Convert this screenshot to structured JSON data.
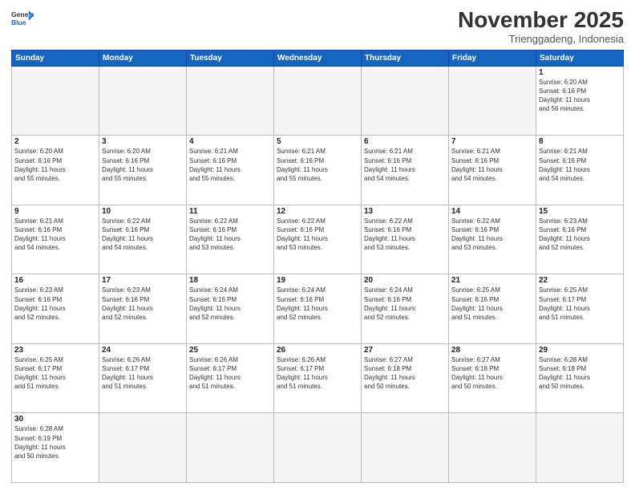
{
  "header": {
    "logo_general": "General",
    "logo_blue": "Blue",
    "month_title": "November 2025",
    "subtitle": "Trienggadeng, Indonesia"
  },
  "weekdays": [
    "Sunday",
    "Monday",
    "Tuesday",
    "Wednesday",
    "Thursday",
    "Friday",
    "Saturday"
  ],
  "weeks": [
    [
      {
        "day": "",
        "info": ""
      },
      {
        "day": "",
        "info": ""
      },
      {
        "day": "",
        "info": ""
      },
      {
        "day": "",
        "info": ""
      },
      {
        "day": "",
        "info": ""
      },
      {
        "day": "",
        "info": ""
      },
      {
        "day": "1",
        "info": "Sunrise: 6:20 AM\nSunset: 6:16 PM\nDaylight: 11 hours\nand 56 minutes."
      }
    ],
    [
      {
        "day": "2",
        "info": "Sunrise: 6:20 AM\nSunset: 6:16 PM\nDaylight: 11 hours\nand 55 minutes."
      },
      {
        "day": "3",
        "info": "Sunrise: 6:20 AM\nSunset: 6:16 PM\nDaylight: 11 hours\nand 55 minutes."
      },
      {
        "day": "4",
        "info": "Sunrise: 6:21 AM\nSunset: 6:16 PM\nDaylight: 11 hours\nand 55 minutes."
      },
      {
        "day": "5",
        "info": "Sunrise: 6:21 AM\nSunset: 6:16 PM\nDaylight: 11 hours\nand 55 minutes."
      },
      {
        "day": "6",
        "info": "Sunrise: 6:21 AM\nSunset: 6:16 PM\nDaylight: 11 hours\nand 54 minutes."
      },
      {
        "day": "7",
        "info": "Sunrise: 6:21 AM\nSunset: 6:16 PM\nDaylight: 11 hours\nand 54 minutes."
      },
      {
        "day": "8",
        "info": "Sunrise: 6:21 AM\nSunset: 6:16 PM\nDaylight: 11 hours\nand 54 minutes."
      }
    ],
    [
      {
        "day": "9",
        "info": "Sunrise: 6:21 AM\nSunset: 6:16 PM\nDaylight: 11 hours\nand 54 minutes."
      },
      {
        "day": "10",
        "info": "Sunrise: 6:22 AM\nSunset: 6:16 PM\nDaylight: 11 hours\nand 54 minutes."
      },
      {
        "day": "11",
        "info": "Sunrise: 6:22 AM\nSunset: 6:16 PM\nDaylight: 11 hours\nand 53 minutes."
      },
      {
        "day": "12",
        "info": "Sunrise: 6:22 AM\nSunset: 6:16 PM\nDaylight: 11 hours\nand 53 minutes."
      },
      {
        "day": "13",
        "info": "Sunrise: 6:22 AM\nSunset: 6:16 PM\nDaylight: 11 hours\nand 53 minutes."
      },
      {
        "day": "14",
        "info": "Sunrise: 6:22 AM\nSunset: 6:16 PM\nDaylight: 11 hours\nand 53 minutes."
      },
      {
        "day": "15",
        "info": "Sunrise: 6:23 AM\nSunset: 6:16 PM\nDaylight: 11 hours\nand 52 minutes."
      }
    ],
    [
      {
        "day": "16",
        "info": "Sunrise: 6:23 AM\nSunset: 6:16 PM\nDaylight: 11 hours\nand 52 minutes."
      },
      {
        "day": "17",
        "info": "Sunrise: 6:23 AM\nSunset: 6:16 PM\nDaylight: 11 hours\nand 52 minutes."
      },
      {
        "day": "18",
        "info": "Sunrise: 6:24 AM\nSunset: 6:16 PM\nDaylight: 11 hours\nand 52 minutes."
      },
      {
        "day": "19",
        "info": "Sunrise: 6:24 AM\nSunset: 6:16 PM\nDaylight: 11 hours\nand 52 minutes."
      },
      {
        "day": "20",
        "info": "Sunrise: 6:24 AM\nSunset: 6:16 PM\nDaylight: 11 hours\nand 52 minutes."
      },
      {
        "day": "21",
        "info": "Sunrise: 6:25 AM\nSunset: 6:16 PM\nDaylight: 11 hours\nand 51 minutes."
      },
      {
        "day": "22",
        "info": "Sunrise: 6:25 AM\nSunset: 6:17 PM\nDaylight: 11 hours\nand 51 minutes."
      }
    ],
    [
      {
        "day": "23",
        "info": "Sunrise: 6:25 AM\nSunset: 6:17 PM\nDaylight: 11 hours\nand 51 minutes."
      },
      {
        "day": "24",
        "info": "Sunrise: 6:26 AM\nSunset: 6:17 PM\nDaylight: 11 hours\nand 51 minutes."
      },
      {
        "day": "25",
        "info": "Sunrise: 6:26 AM\nSunset: 6:17 PM\nDaylight: 11 hours\nand 51 minutes."
      },
      {
        "day": "26",
        "info": "Sunrise: 6:26 AM\nSunset: 6:17 PM\nDaylight: 11 hours\nand 51 minutes."
      },
      {
        "day": "27",
        "info": "Sunrise: 6:27 AM\nSunset: 6:18 PM\nDaylight: 11 hours\nand 50 minutes."
      },
      {
        "day": "28",
        "info": "Sunrise: 6:27 AM\nSunset: 6:18 PM\nDaylight: 11 hours\nand 50 minutes."
      },
      {
        "day": "29",
        "info": "Sunrise: 6:28 AM\nSunset: 6:18 PM\nDaylight: 11 hours\nand 50 minutes."
      }
    ],
    [
      {
        "day": "30",
        "info": "Sunrise: 6:28 AM\nSunset: 6:19 PM\nDaylight: 11 hours\nand 50 minutes."
      },
      {
        "day": "",
        "info": ""
      },
      {
        "day": "",
        "info": ""
      },
      {
        "day": "",
        "info": ""
      },
      {
        "day": "",
        "info": ""
      },
      {
        "day": "",
        "info": ""
      },
      {
        "day": "",
        "info": ""
      }
    ]
  ]
}
